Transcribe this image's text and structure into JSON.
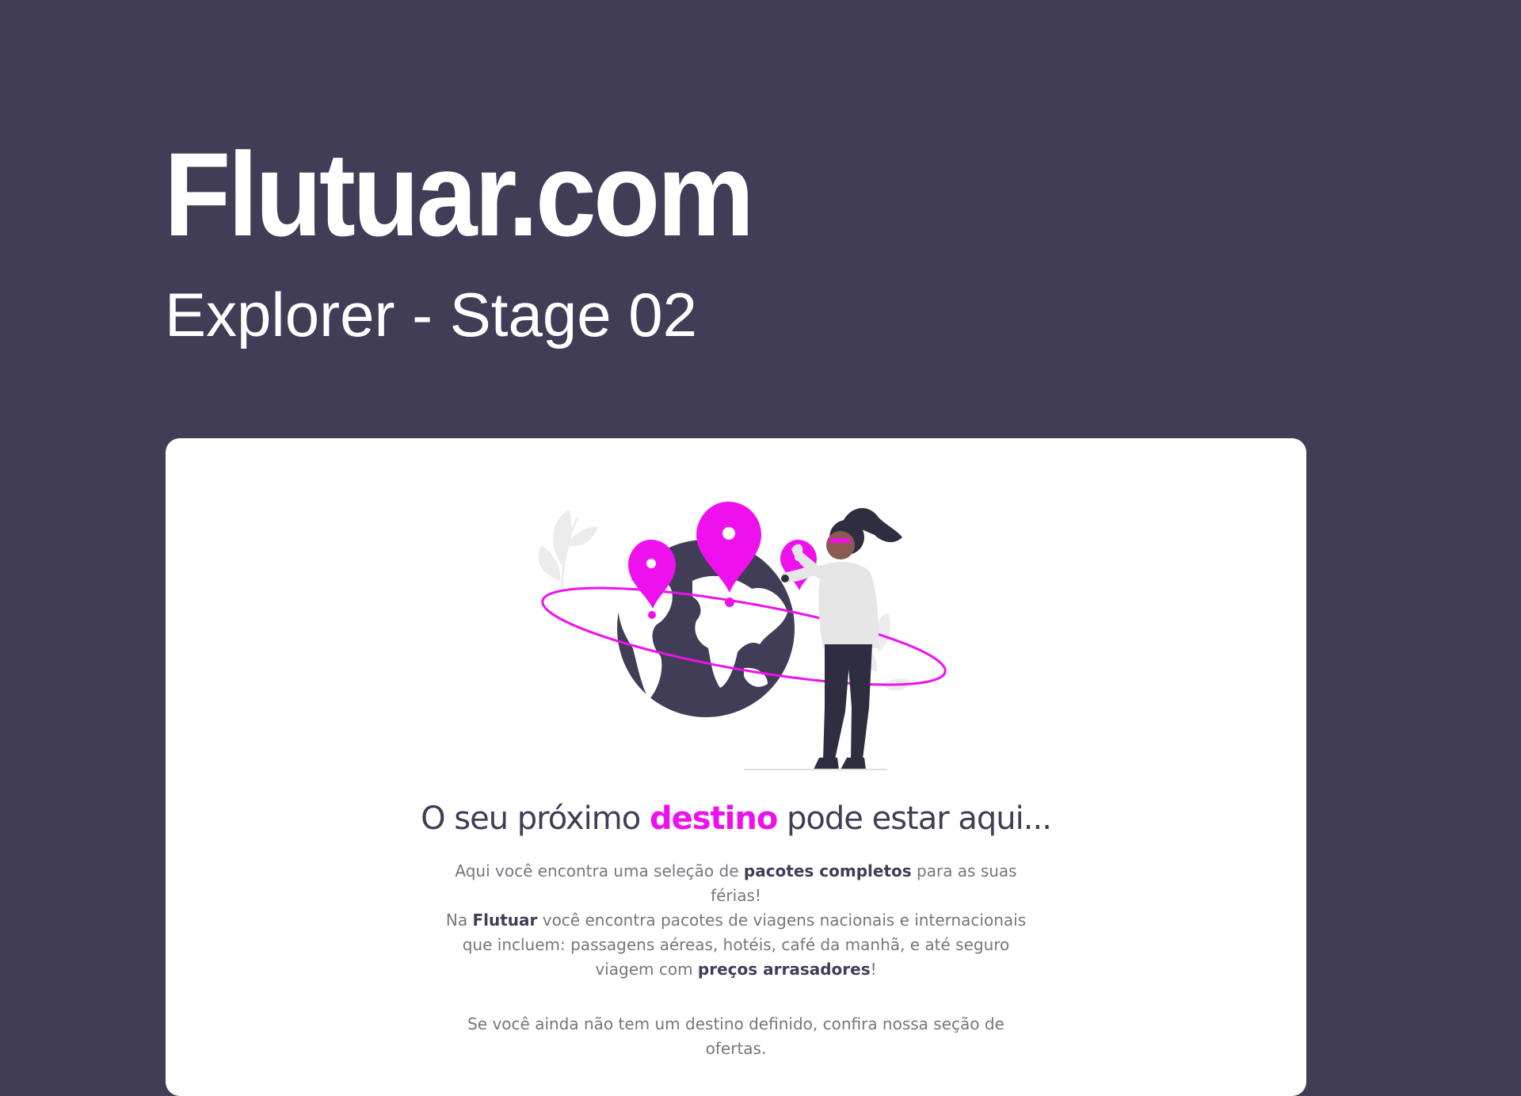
{
  "header": {
    "title": "Flutuar.com",
    "subtitle": "Explorer - Stage 02"
  },
  "colors": {
    "background": "#413d56",
    "card": "#ffffff",
    "accent": "#ee11ee",
    "text_dark": "#413d56",
    "text_muted": "#77757f"
  },
  "card": {
    "illustration_icon": "woman-with-globe-and-pins-illustration",
    "headline": {
      "before": "O seu próximo ",
      "accent": "destino",
      "after": " pode estar aqui..."
    },
    "paragraph1": {
      "t1": "Aqui você encontra uma seleção de ",
      "b1": "pacotes completos",
      "t2": " para as suas férias!"
    },
    "paragraph2": {
      "t1": "Na ",
      "b1": "Flutuar",
      "t2": " você encontra pacotes de viagens nacionais e internacionais que incluem: passagens aéreas, hotéis, café da manhã, e até seguro viagem com ",
      "b2": "preços arrasadores",
      "t3": "!"
    },
    "paragraph3": "Se você ainda não tem um destino definido, confira nossa seção de ofertas."
  }
}
